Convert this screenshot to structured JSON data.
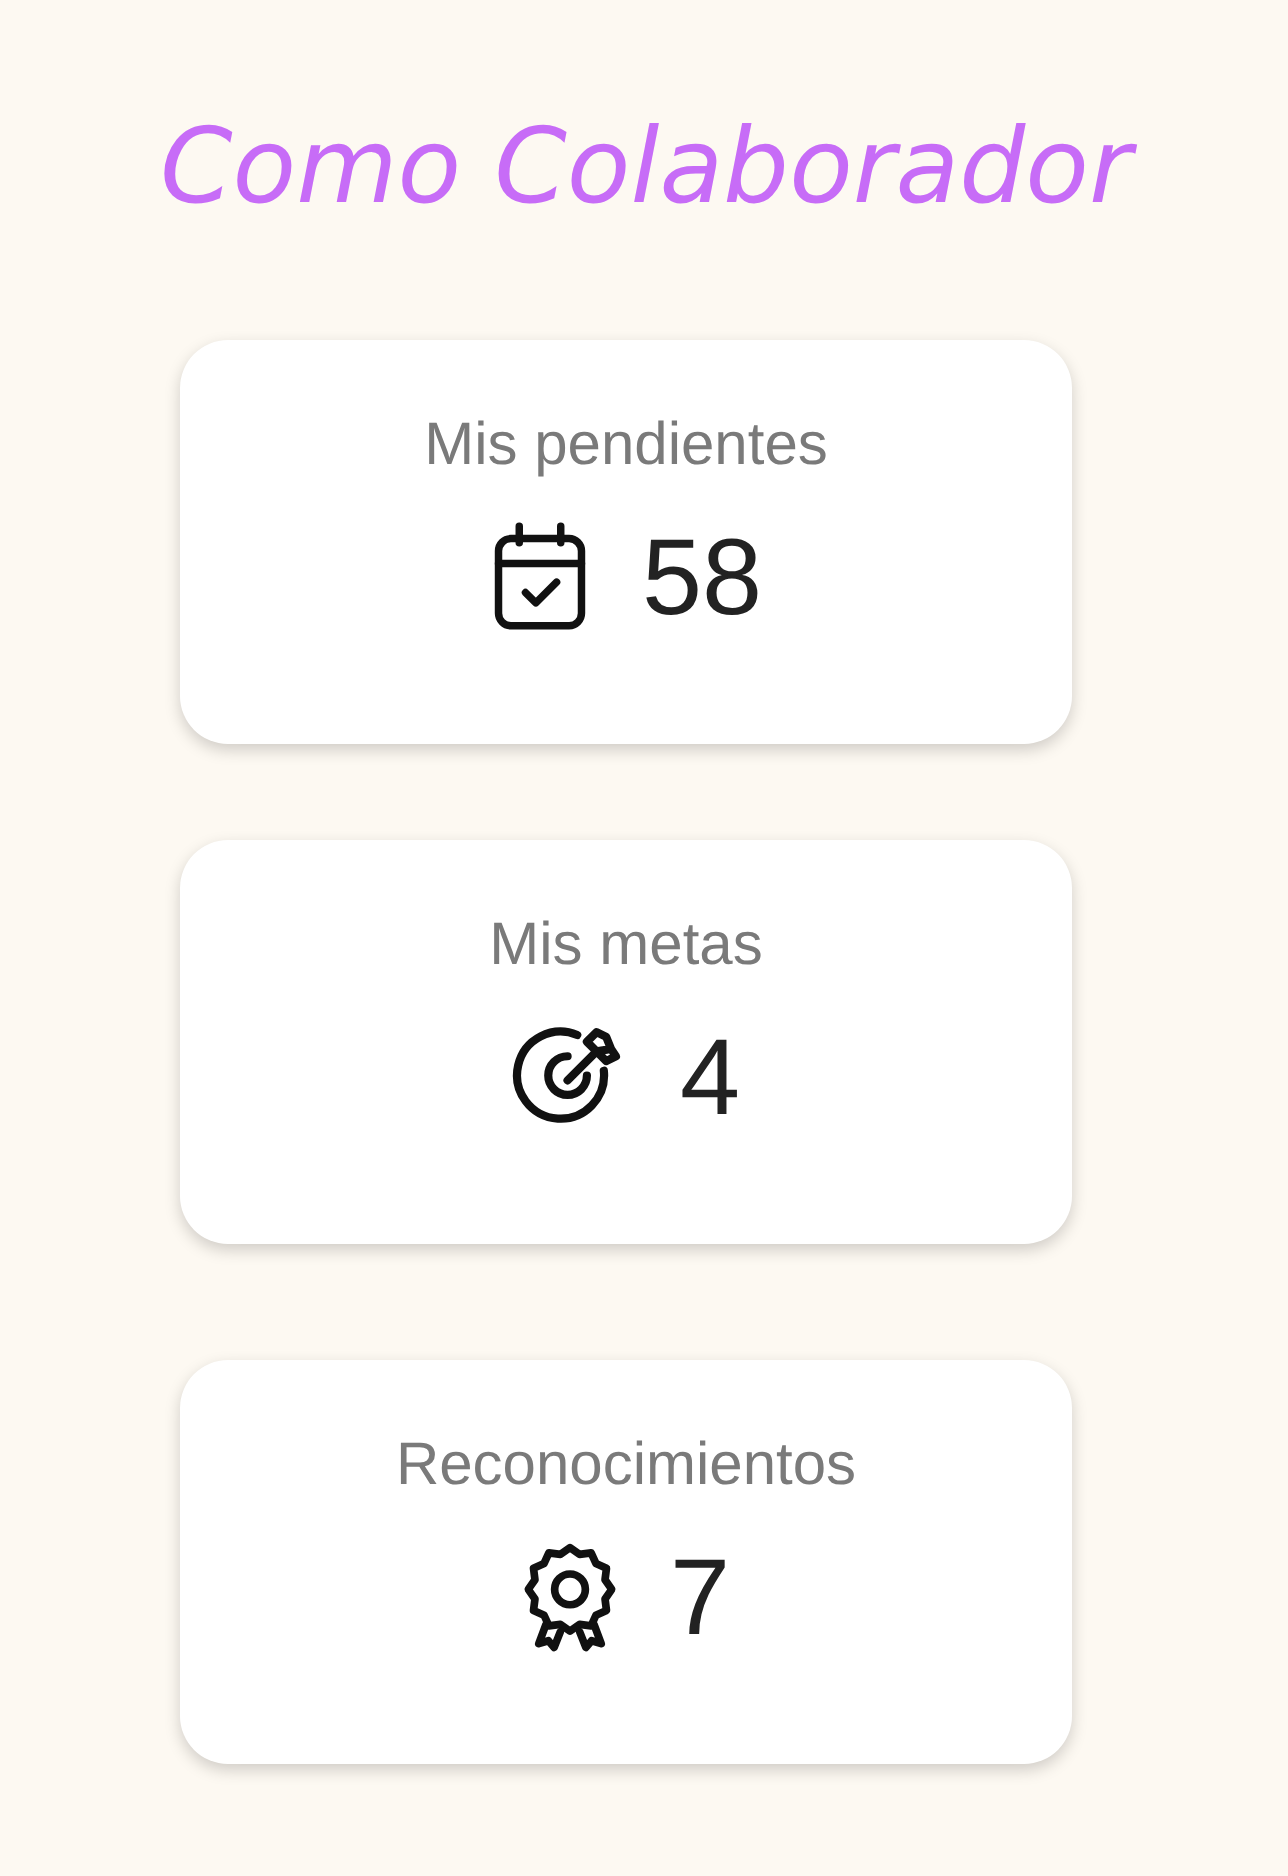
{
  "title": "Como Colaborador",
  "cards": [
    {
      "label": "Mis pendientes",
      "kind": "calendar",
      "count": "58"
    },
    {
      "label": "Mis metas",
      "kind": "target",
      "count": "4"
    },
    {
      "label": "Reconocimientos",
      "kind": "award",
      "count": "7"
    }
  ]
}
